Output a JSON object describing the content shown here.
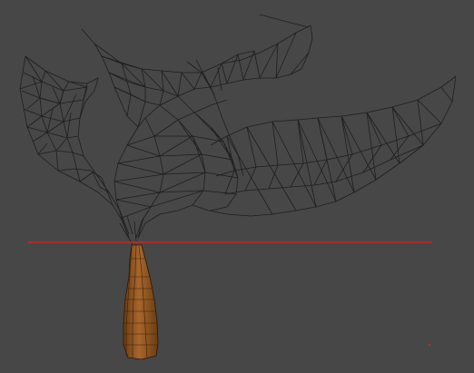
{
  "viewport": {
    "background": "#474747",
    "wire_color": "#1e1e1e",
    "guide_line_color": "#e02020",
    "trunk_colors": {
      "light": "#a8662c",
      "mid": "#8b4f1f",
      "dark": "#5b3410"
    },
    "marker_color": "#d62020"
  }
}
